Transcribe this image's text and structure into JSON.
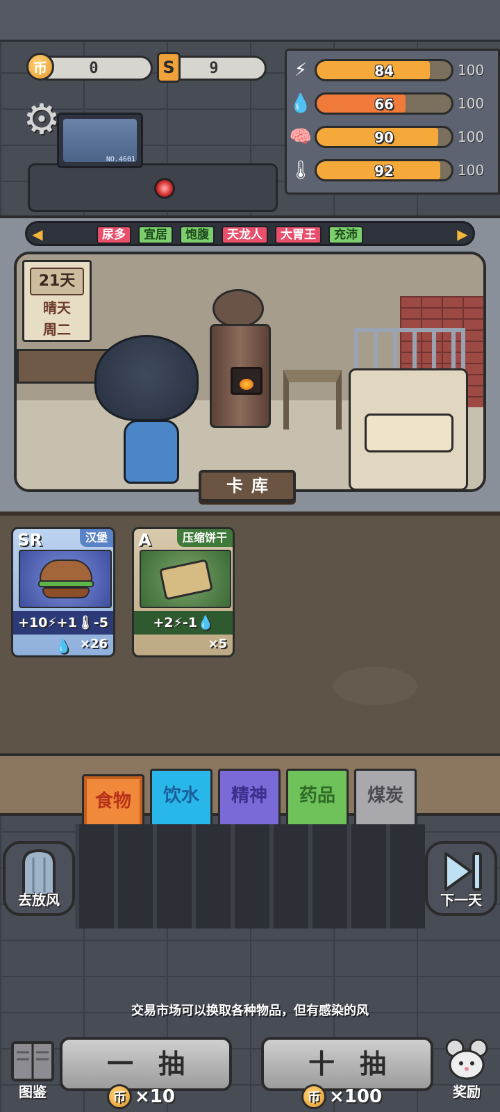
{
  "currency": {
    "coin_icon": "币",
    "coin_value": "0",
    "ticket_icon": "S",
    "ticket_value": "9"
  },
  "stats": [
    {
      "name": "energy",
      "icon": "lightning-icon",
      "glyph": "⚡",
      "value": "84",
      "max": "100",
      "fraction": 0.84,
      "color": "#f5a93a"
    },
    {
      "name": "water",
      "icon": "water-drop-icon",
      "glyph": "💧",
      "value": "66",
      "max": "100",
      "fraction": 0.66,
      "color": "#f07a3a"
    },
    {
      "name": "mind",
      "icon": "brain-icon",
      "glyph": "🧠",
      "value": "90",
      "max": "100",
      "fraction": 0.9,
      "color": "#f5a93a"
    },
    {
      "name": "temperature",
      "icon": "thermometer-icon",
      "glyph": "🌡",
      "value": "92",
      "max": "100",
      "fraction": 0.92,
      "color": "#f5a93a"
    }
  ],
  "monitor": {
    "number": "NO.4601"
  },
  "traits": {
    "left_arrow": "◀",
    "right_arrow": "▶",
    "items": [
      {
        "label": "尿多",
        "color": "red"
      },
      {
        "label": "宜居",
        "color": "green"
      },
      {
        "label": "饱腹",
        "color": "green"
      },
      {
        "label": "天龙人",
        "color": "red"
      },
      {
        "label": "大胃王",
        "color": "red"
      },
      {
        "label": "充沛",
        "color": "green"
      }
    ]
  },
  "calendar": {
    "day": "21天",
    "weather": "晴天",
    "weekday": "周二"
  },
  "scene_button": "卡库",
  "cards": [
    {
      "rank": "SR",
      "name": "汉堡",
      "effect": "+10⚡+1🌡-5💧",
      "count": "×26"
    },
    {
      "rank": "A",
      "name": "压缩饼干",
      "effect": "+2⚡-1💧",
      "count": "×5"
    }
  ],
  "categories": [
    {
      "label": "食物",
      "bg": "#f08a3a",
      "fg": "#b8321a",
      "active": true
    },
    {
      "label": "饮水",
      "bg": "#29b6e8",
      "fg": "#1a5f9c",
      "active": false
    },
    {
      "label": "精神",
      "bg": "#7a6ad8",
      "fg": "#3a2f8a",
      "active": false
    },
    {
      "label": "药品",
      "bg": "#6fc25a",
      "fg": "#2f6a28",
      "active": false
    },
    {
      "label": "煤炭",
      "bg": "#a8a8ad",
      "fg": "#4a4a50",
      "active": false
    }
  ],
  "side": {
    "left_label": "去放风",
    "right_label": "下一天"
  },
  "hint": "交易市场可以换取各种物品，但有感染的风",
  "draw": {
    "single_label": "一抽",
    "single_cost": "×10",
    "ten_label": "十抽",
    "ten_cost": "×100"
  },
  "corners": {
    "left_label": "图鉴",
    "right_label": "奖励"
  }
}
